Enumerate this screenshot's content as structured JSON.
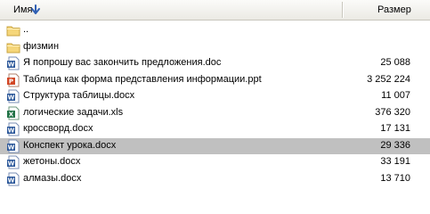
{
  "header": {
    "name_label": "Имя",
    "sort_icon": "arrow-down-icon",
    "size_label": "Размер"
  },
  "colors": {
    "selected_row": "#c0c0c0",
    "folder": "#f5d67a",
    "word": "#2b579a",
    "powerpoint": "#d24726",
    "excel": "#217346"
  },
  "files": [
    {
      "name": "..",
      "size": "",
      "icon": "folder-icon",
      "selected": false
    },
    {
      "name": "физмин",
      "size": "",
      "icon": "folder-icon",
      "selected": false
    },
    {
      "name": "Я попрошу вас закончить предложения.doc",
      "size": "25 088",
      "icon": "word-doc-icon",
      "selected": false
    },
    {
      "name": "Таблица как форма представления информации.ppt",
      "size": "3 252 224",
      "icon": "powerpoint-icon",
      "selected": false
    },
    {
      "name": "Структура таблицы.docx",
      "size": "11 007",
      "icon": "word-doc-icon",
      "selected": false
    },
    {
      "name": "логические задачи.xls",
      "size": "376 320",
      "icon": "excel-icon",
      "selected": false
    },
    {
      "name": "кроссворд.docx",
      "size": "17 131",
      "icon": "word-doc-icon",
      "selected": false
    },
    {
      "name": "Конспект урока.docx",
      "size": "29 336",
      "icon": "word-doc-icon",
      "selected": true
    },
    {
      "name": "жетоны.docx",
      "size": "33 191",
      "icon": "word-doc-icon",
      "selected": false
    },
    {
      "name": "алмазы.docx",
      "size": "13 710",
      "icon": "word-doc-icon",
      "selected": false
    }
  ]
}
